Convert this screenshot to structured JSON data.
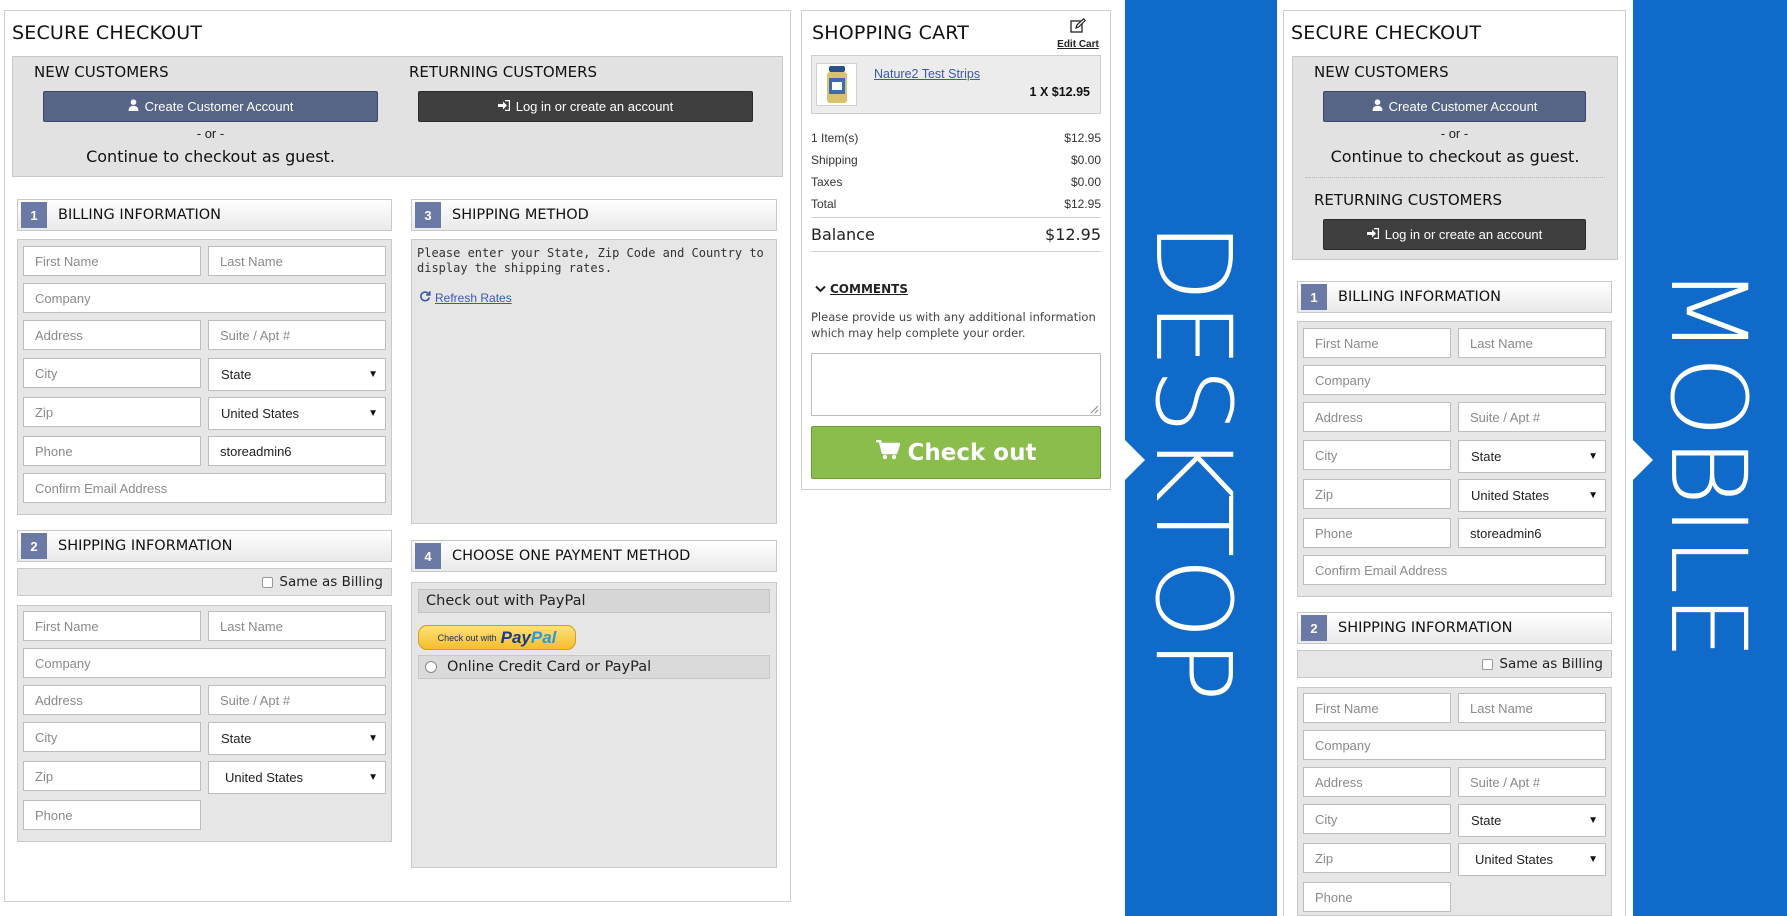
{
  "desktop": {
    "title": "SECURE CHECKOUT",
    "new_customers_title": "NEW CUSTOMERS",
    "returning_customers_title": "RETURNING CUSTOMERS",
    "create_account_label": "Create Customer Account",
    "login_label": "Log in or create an account",
    "or_text": "- or -",
    "guest_text": "Continue to checkout as guest.",
    "billing": {
      "num": "1",
      "title": "BILLING INFORMATION",
      "first_name_ph": "First Name",
      "last_name_ph": "Last Name",
      "company_ph": "Company",
      "address_ph": "Address",
      "suite_ph": "Suite / Apt #",
      "city_ph": "City",
      "state_value": "State",
      "zip_ph": "Zip",
      "country_value": "United States",
      "phone_ph": "Phone",
      "phone2_value": "storeadmin6",
      "email_ph": "Confirm Email Address"
    },
    "shipping_info": {
      "num": "2",
      "title": "SHIPPING INFORMATION",
      "same_as_billing": "Same as Billing",
      "first_name_ph": "First Name",
      "last_name_ph": "Last Name",
      "company_ph": "Company",
      "address_ph": "Address",
      "suite_ph": "Suite / Apt #",
      "city_ph": "City",
      "state_value": "State",
      "zip_ph": "Zip",
      "country_value": "United States",
      "phone_ph": "Phone"
    },
    "shipping_method": {
      "num": "3",
      "title": "SHIPPING METHOD",
      "message": "Please enter your State, Zip Code and Country to display the shipping rates.",
      "refresh_label": "Refresh Rates"
    },
    "payment": {
      "num": "4",
      "title": "CHOOSE ONE PAYMENT METHOD",
      "paypal_heading": "Check out with PayPal",
      "paypal_btn_small": "Check out with",
      "paypal_brand_1": "Pay",
      "paypal_brand_2": "Pal",
      "option_label": "Online Credit Card or PayPal"
    }
  },
  "cart": {
    "title": "SHOPPING CART",
    "edit_label": "Edit Cart",
    "item_name": "Nature2 Test Strips",
    "item_qty_price": "1 X $12.95",
    "summary": [
      {
        "label": "1 Item(s)",
        "value": "$12.95"
      },
      {
        "label": "Shipping",
        "value": "$0.00"
      },
      {
        "label": "Taxes",
        "value": "$0.00"
      },
      {
        "label": "Total",
        "value": "$12.95"
      }
    ],
    "balance_label": "Balance",
    "balance_value": "$12.95",
    "comments_title": "COMMENTS",
    "comments_help": "Please provide us with any additional information which may help complete your order.",
    "checkout_label": "Check out"
  },
  "labels": {
    "desktop": "DESKTOP",
    "mobile": "MOBILE"
  },
  "mobile": {
    "title": "SECURE CHECKOUT",
    "new_customers_title": "NEW CUSTOMERS",
    "create_account_label": "Create Customer Account",
    "or_text": "- or -",
    "guest_text": "Continue to checkout as guest.",
    "returning_customers_title": "RETURNING CUSTOMERS",
    "login_label": "Log in or create an account",
    "billing": {
      "num": "1",
      "title": "BILLING INFORMATION",
      "first_name_ph": "First Name",
      "last_name_ph": "Last Name",
      "company_ph": "Company",
      "address_ph": "Address",
      "suite_ph": "Suite / Apt #",
      "city_ph": "City",
      "state_value": "State",
      "zip_ph": "Zip",
      "country_value": "United States",
      "phone_ph": "Phone",
      "phone2_value": "storeadmin6",
      "email_ph": "Confirm Email Address"
    },
    "shipping_info": {
      "num": "2",
      "title": "SHIPPING INFORMATION",
      "same_as_billing": "Same as Billing",
      "first_name_ph": "First Name",
      "last_name_ph": "Last Name",
      "company_ph": "Company",
      "address_ph": "Address",
      "suite_ph": "Suite / Apt #",
      "city_ph": "City",
      "state_value": "State",
      "zip_ph": "Zip",
      "country_value": "United States",
      "phone_ph": "Phone"
    }
  },
  "colors": {
    "accent_blue_band": "#0f6ac9",
    "checkout_green": "#8bbd4c",
    "create_account_blue": "#566486",
    "login_dark": "#3f3f3f",
    "section_badge": "#6b79a6"
  },
  "icons": [
    "user-icon",
    "sign-in-icon",
    "edit-icon",
    "refresh-icon",
    "chevron-down-icon",
    "cart-icon"
  ]
}
